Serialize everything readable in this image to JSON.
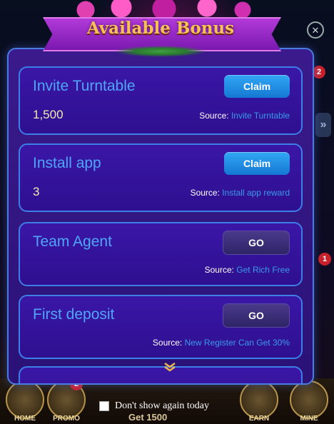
{
  "modal": {
    "title": "Available Bonus",
    "items": [
      {
        "title": "Invite Turntable",
        "amount": "1,500",
        "button": "Claim",
        "source_prefix": "Source: ",
        "source": "Invite Turntable"
      },
      {
        "title": "Install app",
        "amount": "3",
        "button": "Claim",
        "source_prefix": "Source: ",
        "source": "Install app reward"
      },
      {
        "title": "Team Agent",
        "amount": "",
        "button": "GO",
        "source_prefix": "Source: ",
        "source": "Get Rich Free"
      },
      {
        "title": "First deposit",
        "amount": "",
        "button": "GO",
        "source_prefix": "Source: ",
        "source": "New Register Can Get 30%"
      },
      {
        "title": "",
        "amount": "",
        "button": "",
        "source_prefix": "",
        "source": ""
      }
    ],
    "close_icon": "close-icon",
    "scroll_icon": "chevron-down-icon"
  },
  "footer": {
    "dont_show_label": "Don't show again today",
    "checked": false
  },
  "background": {
    "nav": [
      {
        "label": "HOME",
        "badge": ""
      },
      {
        "label": "PROMO",
        "badge": "2"
      },
      {
        "label": "EARN",
        "badge": ""
      },
      {
        "label": "MINE",
        "badge": ""
      }
    ],
    "get_label": "Get 1500",
    "side_badges": [
      "2",
      "1"
    ]
  },
  "colors": {
    "modal_bg": "#2e1090",
    "card_border": "#3d7ee8",
    "title_blue": "#4fa6f7",
    "claim_button": "#1e8fe8",
    "go_button": "#3a2c78",
    "source_link": "#3a9ae8",
    "banner": "#9a28c8",
    "banner_text": "#f7c15a"
  }
}
